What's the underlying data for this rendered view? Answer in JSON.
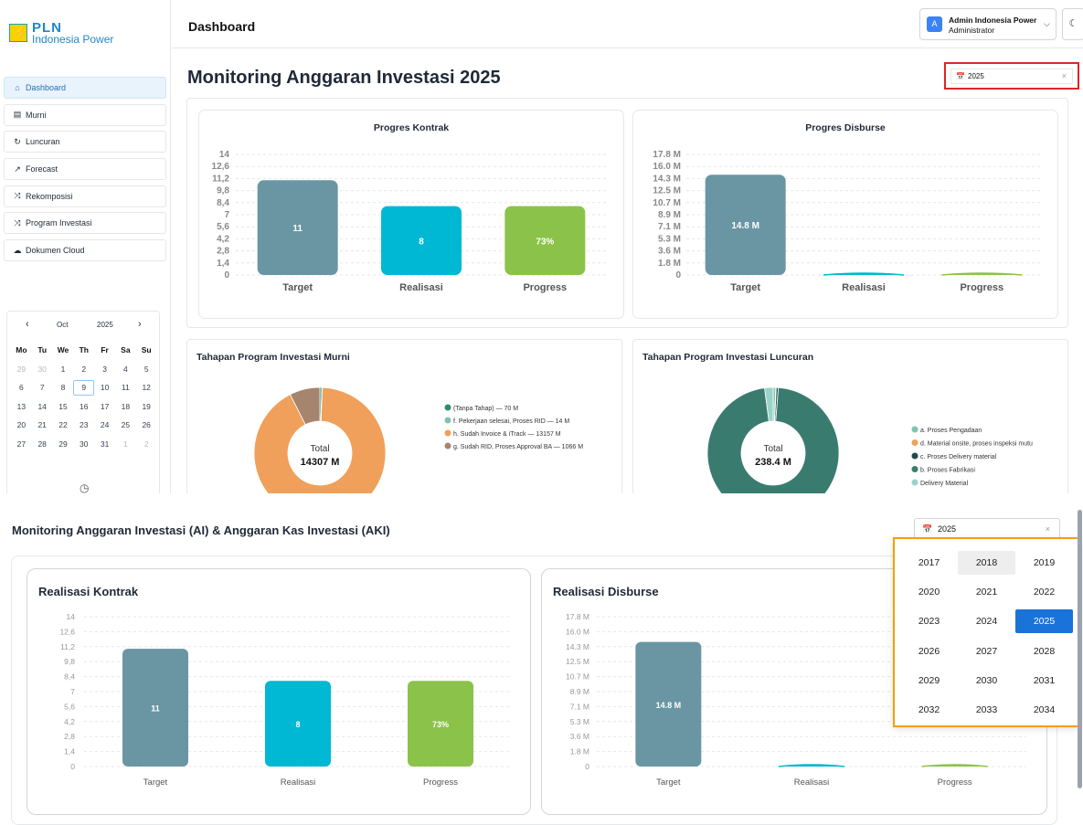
{
  "brand": {
    "title": "PLN",
    "subtitle": "Indonesia Power"
  },
  "sidebar": {
    "items": [
      {
        "label": "Dashboard",
        "icon": "home-icon",
        "glyph": "⌂",
        "active": true
      },
      {
        "label": "Murni",
        "icon": "file-icon",
        "glyph": "▤",
        "active": false
      },
      {
        "label": "Luncuran",
        "icon": "refresh-icon",
        "glyph": "↻",
        "active": false
      },
      {
        "label": "Forecast",
        "icon": "trend-icon",
        "glyph": "↗",
        "active": false
      },
      {
        "label": "Rekomposisi",
        "icon": "shuffle-icon",
        "glyph": "⤨",
        "active": false
      },
      {
        "label": "Program Investasi",
        "icon": "shuffle-icon",
        "glyph": "⤨",
        "active": false
      },
      {
        "label": "Dokumen Cloud",
        "icon": "cloud-icon",
        "glyph": "☁",
        "active": false
      }
    ],
    "calendar": {
      "month": "Oct",
      "year": "2025",
      "prev": "‹",
      "next": "›",
      "weekdays": [
        "Mo",
        "Tu",
        "We",
        "Th",
        "Fr",
        "Sa",
        "Su"
      ],
      "weeks": [
        [
          "29",
          "30",
          "1",
          "2",
          "3",
          "4",
          "5"
        ],
        [
          "6",
          "7",
          "8",
          "9",
          "10",
          "11",
          "12"
        ],
        [
          "13",
          "14",
          "15",
          "16",
          "17",
          "18",
          "19"
        ],
        [
          "20",
          "21",
          "22",
          "23",
          "24",
          "25",
          "26"
        ],
        [
          "27",
          "28",
          "29",
          "30",
          "31",
          "1",
          "2"
        ]
      ],
      "today": "9"
    }
  },
  "header": {
    "title": "Dashboard",
    "user_name": "Admin Indonesia Power",
    "user_role": "Administrator",
    "avatar": "A"
  },
  "main": {
    "title": "Monitoring Anggaran Investasi 2025",
    "year_filter": "2025"
  },
  "colors": {
    "target": "#6a96a3",
    "realisasi": "#00b8d4",
    "progress": "#8bc34a",
    "accent": "#1a73d9",
    "highlight_red": "#dc2626",
    "highlight_orange": "#f59e0b"
  },
  "chart_data": [
    {
      "type": "bar",
      "title": "Progres Kontrak",
      "categories": [
        "Target",
        "Realisasi",
        "Progress"
      ],
      "values": [
        11,
        8,
        8
      ],
      "labels": [
        "11",
        "8",
        "73%"
      ],
      "yticks": [
        "0",
        "1,4",
        "2,8",
        "4,2",
        "5,6",
        "7",
        "8,4",
        "9,8",
        "11,2",
        "12,6",
        "14"
      ],
      "ylim": [
        0,
        14
      ]
    },
    {
      "type": "bar",
      "title": "Progres Disburse",
      "categories": [
        "Target",
        "Realisasi",
        "Progress"
      ],
      "values": [
        14.8,
        0.05,
        0.05
      ],
      "labels": [
        "14.8 M",
        "",
        ""
      ],
      "yticks": [
        "0",
        "1.8 M",
        "3.6 M",
        "5.3 M",
        "7.1 M",
        "8.9 M",
        "10.7 M",
        "12.5 M",
        "14.3 M",
        "16.0 M",
        "17.8 M"
      ],
      "ylim": [
        0,
        17.8
      ]
    },
    {
      "type": "pie",
      "title": "Tahapan Program Investasi Murni",
      "center_label": "Total",
      "center_value": "14307 M",
      "slices": [
        {
          "label": "(Tanpa Tahap) — 70 M",
          "value": 70,
          "color": "#2e8b73"
        },
        {
          "label": "f. Pekerjaan selesai, Proses RID — 14 M",
          "value": 14,
          "color": "#7ec4b4"
        },
        {
          "label": "h. Sudah Invoice & iTrack — 13157 M",
          "value": 13157,
          "color": "#f0a05a"
        },
        {
          "label": "g. Sudah RID, Proses Approval BA — 1066 M",
          "value": 1066,
          "color": "#a5856e"
        }
      ]
    },
    {
      "type": "pie",
      "title": "Tahapan Program Investasi Luncuran",
      "center_label": "Total",
      "center_value": "238.4 M",
      "slices": [
        {
          "label": "a. Proses Pengadaan",
          "value": 1.5,
          "color": "#7ec4b4"
        },
        {
          "label": "d. Material onsite, proses inspeksi mutu",
          "value": 0.3,
          "color": "#f0a05a"
        },
        {
          "label": "c. Proses Delivery material",
          "value": 1.2,
          "color": "#1e4d45"
        },
        {
          "label": "b. Proses Fabrikasi",
          "value": 230.4,
          "color": "#3a7b70"
        },
        {
          "label": "Delivery Material",
          "value": 5.0,
          "color": "#9bd3c8"
        }
      ]
    },
    {
      "type": "bar",
      "title": "Realisasi Kontrak",
      "categories": [
        "Target",
        "Realisasi",
        "Progress"
      ],
      "values": [
        11,
        8,
        8
      ],
      "labels": [
        "11",
        "8",
        "73%"
      ],
      "yticks": [
        "0",
        "1,4",
        "2,8",
        "4,2",
        "5,6",
        "7",
        "8,4",
        "9,8",
        "11,2",
        "12,6",
        "14"
      ],
      "ylim": [
        0,
        14
      ]
    },
    {
      "type": "bar",
      "title": "Realisasi Disburse",
      "categories": [
        "Target",
        "Realisasi",
        "Progress"
      ],
      "values": [
        14.8,
        0.05,
        0.05
      ],
      "labels": [
        "14.8 M",
        "",
        ""
      ],
      "yticks": [
        "0",
        "1.8 M",
        "3.6 M",
        "5.3 M",
        "7.1 M",
        "8.9 M",
        "10.7 M",
        "12.5 M",
        "14.3 M",
        "16.0 M",
        "17.8 M"
      ],
      "ylim": [
        0,
        17.8
      ]
    }
  ],
  "bottom": {
    "title": "Monitoring Anggaran Investasi (AI) & Anggaran Kas Investasi (AKI)",
    "year_filter": "2025",
    "year_picker": {
      "years": [
        [
          "2017",
          "2018",
          "2019"
        ],
        [
          "2020",
          "2021",
          "2022"
        ],
        [
          "2023",
          "2024",
          "2025"
        ],
        [
          "2026",
          "2027",
          "2028"
        ],
        [
          "2029",
          "2030",
          "2031"
        ],
        [
          "2032",
          "2033",
          "2034"
        ]
      ],
      "selected": "2025",
      "hovered": "2018"
    }
  },
  "icons": {
    "calendar": "📅",
    "clear": "×",
    "chevron_down": "⌵",
    "theme": "☾",
    "clock": "◷"
  }
}
